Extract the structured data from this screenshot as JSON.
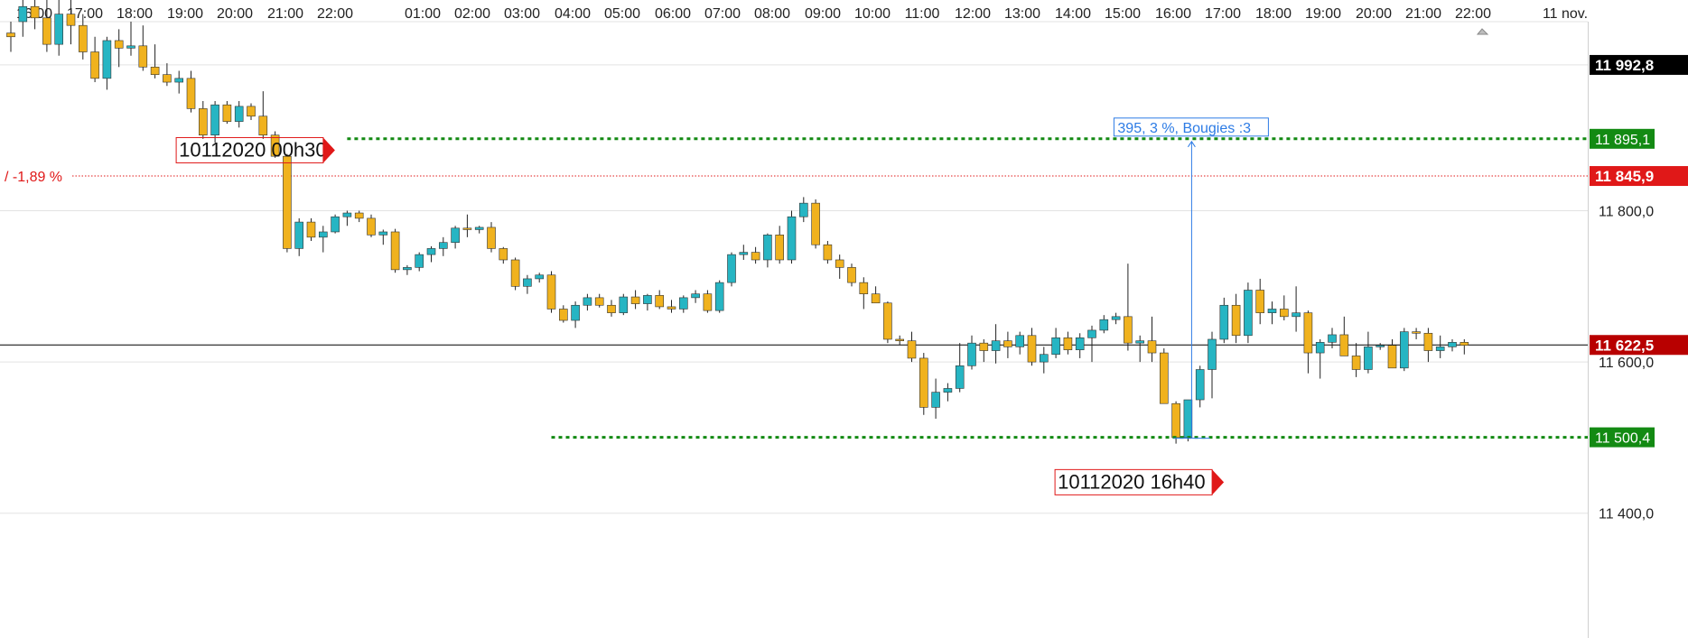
{
  "chart_data": {
    "type": "candlestick",
    "time_axis": {
      "labels": [
        "16:00",
        "17:00",
        "18:00",
        "19:00",
        "20:00",
        "21:00",
        "22:00",
        "01:00",
        "02:00",
        "03:00",
        "04:00",
        "05:00",
        "06:00",
        "07:00",
        "08:00",
        "09:00",
        "10:00",
        "11:00",
        "12:00",
        "13:00",
        "14:00",
        "15:00",
        "16:00",
        "17:00",
        "18:00",
        "19:00",
        "20:00",
        "21:00",
        "22:00",
        "11 nov."
      ]
    },
    "price_axis": {
      "ylim": [
        11235,
        12050
      ],
      "ticks": [
        "11 992,8",
        "11 800,0",
        "11 600,0",
        "11 400,0"
      ],
      "tick_values": [
        11992.8,
        11800.0,
        11600.0,
        11400.0
      ],
      "gridlines": [
        11992.8,
        11800.0,
        11600.0,
        11400.0
      ]
    },
    "price_badges": [
      {
        "label": "11 992,8",
        "value": 11992.8,
        "color": "#000000"
      },
      {
        "label": "11 895,1",
        "value": 11895.1,
        "color": "#138a13"
      },
      {
        "label": "11 845,9",
        "value": 11845.9,
        "color": "#e01818"
      },
      {
        "label": "11 622,5",
        "value": 11622.5,
        "color": "#b80000"
      },
      {
        "label": "11 500,4",
        "value": 11500.4,
        "color": "#138a13"
      }
    ],
    "reference_line": {
      "value": 11845.9,
      "label": "/ -1,89 %",
      "color": "#e01818"
    },
    "current_price_line": {
      "value": 11622.5,
      "color": "#000000"
    },
    "levels": [
      {
        "value": 11895.1,
        "color": "#138a13",
        "from_candle": 28
      },
      {
        "value": 11500.4,
        "color": "#138a13",
        "from_candle": 45
      }
    ],
    "markers": [
      {
        "text": "10112020 00h30",
        "candle": 23,
        "value": 11880
      },
      {
        "text": "10112020  16h40",
        "candle": 97,
        "value": 11441
      }
    ],
    "measure": {
      "label": "395, 3 %, Bougies :3",
      "candle": 98,
      "from": 11500.4,
      "to": 11895.1
    },
    "colors": {
      "up": "#26b5c3",
      "down": "#f0b21e",
      "wick": "#222222"
    },
    "candles": [
      [
        12035,
        12050,
        12010,
        12030
      ],
      [
        12050,
        12085,
        12030,
        12070
      ],
      [
        12070,
        12120,
        12040,
        12055
      ],
      [
        12055,
        12095,
        12010,
        12020
      ],
      [
        12020,
        12080,
        12005,
        12060
      ],
      [
        12060,
        12110,
        12020,
        12045
      ],
      [
        12045,
        12060,
        12000,
        12010
      ],
      [
        12010,
        12030,
        11970,
        11975
      ],
      [
        11975,
        12030,
        11960,
        12025
      ],
      [
        12025,
        12040,
        11990,
        12015
      ],
      [
        12015,
        12050,
        12005,
        12018
      ],
      [
        12018,
        12045,
        11985,
        11990
      ],
      [
        11990,
        12020,
        11975,
        11980
      ],
      [
        11980,
        11995,
        11965,
        11970
      ],
      [
        11970,
        11985,
        11955,
        11975
      ],
      [
        11975,
        11985,
        11930,
        11935
      ],
      [
        11935,
        11945,
        11895,
        11900
      ],
      [
        11900,
        11945,
        11890,
        11940
      ],
      [
        11940,
        11945,
        11915,
        11918
      ],
      [
        11918,
        11945,
        11910,
        11938
      ],
      [
        11938,
        11942,
        11920,
        11925
      ],
      [
        11925,
        11958,
        11895,
        11900
      ],
      [
        11900,
        11905,
        11870,
        11872
      ],
      [
        11872,
        11875,
        11745,
        11750
      ],
      [
        11750,
        11790,
        11740,
        11785
      ],
      [
        11785,
        11790,
        11760,
        11765
      ],
      [
        11765,
        11780,
        11745,
        11772
      ],
      [
        11772,
        11795,
        11770,
        11792
      ],
      [
        11792,
        11800,
        11780,
        11797
      ],
      [
        11797,
        11800,
        11785,
        11790
      ],
      [
        11790,
        11795,
        11765,
        11768
      ],
      [
        11768,
        11775,
        11755,
        11772
      ],
      [
        11772,
        11776,
        11718,
        11722
      ],
      [
        11722,
        11728,
        11715,
        11725
      ],
      [
        11725,
        11745,
        11720,
        11742
      ],
      [
        11742,
        11753,
        11732,
        11750
      ],
      [
        11750,
        11765,
        11740,
        11758
      ],
      [
        11758,
        11780,
        11750,
        11777
      ],
      [
        11777,
        11795,
        11765,
        11775
      ],
      [
        11775,
        11780,
        11770,
        11778
      ],
      [
        11778,
        11785,
        11745,
        11750
      ],
      [
        11750,
        11752,
        11730,
        11735
      ],
      [
        11735,
        11738,
        11695,
        11700
      ],
      [
        11700,
        11715,
        11690,
        11710
      ],
      [
        11710,
        11718,
        11705,
        11715
      ],
      [
        11715,
        11720,
        11665,
        11670
      ],
      [
        11670,
        11675,
        11652,
        11655
      ],
      [
        11655,
        11680,
        11645,
        11675
      ],
      [
        11675,
        11690,
        11668,
        11685
      ],
      [
        11685,
        11690,
        11672,
        11675
      ],
      [
        11675,
        11682,
        11660,
        11665
      ],
      [
        11665,
        11690,
        11662,
        11686
      ],
      [
        11686,
        11695,
        11670,
        11677
      ],
      [
        11677,
        11690,
        11668,
        11688
      ],
      [
        11688,
        11695,
        11670,
        11673
      ],
      [
        11673,
        11682,
        11665,
        11670
      ],
      [
        11670,
        11688,
        11665,
        11685
      ],
      [
        11685,
        11695,
        11678,
        11690
      ],
      [
        11690,
        11695,
        11665,
        11668
      ],
      [
        11668,
        11708,
        11665,
        11705
      ],
      [
        11705,
        11745,
        11700,
        11742
      ],
      [
        11742,
        11755,
        11735,
        11745
      ],
      [
        11745,
        11752,
        11730,
        11735
      ],
      [
        11735,
        11770,
        11725,
        11768
      ],
      [
        11768,
        11780,
        11730,
        11735
      ],
      [
        11735,
        11800,
        11730,
        11792
      ],
      [
        11792,
        11818,
        11785,
        11810
      ],
      [
        11810,
        11815,
        11750,
        11755
      ],
      [
        11755,
        11760,
        11730,
        11735
      ],
      [
        11735,
        11742,
        11710,
        11725
      ],
      [
        11725,
        11730,
        11700,
        11705
      ],
      [
        11705,
        11712,
        11670,
        11690
      ],
      [
        11690,
        11700,
        11680,
        11678
      ],
      [
        11678,
        11680,
        11625,
        11630
      ],
      [
        11630,
        11635,
        11622,
        11628
      ],
      [
        11628,
        11640,
        11600,
        11605
      ],
      [
        11605,
        11612,
        11530,
        11540
      ],
      [
        11540,
        11578,
        11525,
        11560
      ],
      [
        11560,
        11572,
        11548,
        11565
      ],
      [
        11565,
        11625,
        11560,
        11595
      ],
      [
        11595,
        11635,
        11590,
        11625
      ],
      [
        11625,
        11630,
        11600,
        11615
      ],
      [
        11615,
        11650,
        11598,
        11628
      ],
      [
        11628,
        11640,
        11605,
        11620
      ],
      [
        11620,
        11640,
        11610,
        11635
      ],
      [
        11635,
        11645,
        11595,
        11600
      ],
      [
        11600,
        11620,
        11585,
        11610
      ],
      [
        11610,
        11645,
        11605,
        11632
      ],
      [
        11632,
        11640,
        11610,
        11616
      ],
      [
        11616,
        11638,
        11605,
        11632
      ],
      [
        11632,
        11648,
        11600,
        11642
      ],
      [
        11642,
        11662,
        11638,
        11656
      ],
      [
        11656,
        11665,
        11650,
        11660
      ],
      [
        11660,
        11730,
        11615,
        11625
      ],
      [
        11625,
        11635,
        11600,
        11628
      ],
      [
        11628,
        11660,
        11600,
        11612
      ],
      [
        11612,
        11618,
        11545,
        11545
      ],
      [
        11545,
        11548,
        11492,
        11500
      ],
      [
        11500,
        11550,
        11495,
        11550
      ],
      [
        11550,
        11595,
        11540,
        11590
      ],
      [
        11590,
        11640,
        11552,
        11630
      ],
      [
        11630,
        11685,
        11625,
        11675
      ],
      [
        11675,
        11690,
        11625,
        11635
      ],
      [
        11635,
        11705,
        11625,
        11695
      ],
      [
        11695,
        11710,
        11650,
        11665
      ],
      [
        11665,
        11680,
        11650,
        11670
      ],
      [
        11670,
        11688,
        11655,
        11660
      ],
      [
        11660,
        11700,
        11640,
        11665
      ],
      [
        11665,
        11668,
        11585,
        11612
      ],
      [
        11612,
        11630,
        11578,
        11626
      ],
      [
        11626,
        11645,
        11618,
        11636
      ],
      [
        11636,
        11660,
        11608,
        11608
      ],
      [
        11608,
        11625,
        11580,
        11590
      ],
      [
        11590,
        11640,
        11585,
        11620
      ],
      [
        11620,
        11625,
        11616,
        11622
      ],
      [
        11622,
        11630,
        11592,
        11592
      ],
      [
        11592,
        11645,
        11588,
        11640
      ],
      [
        11640,
        11645,
        11630,
        11638
      ],
      [
        11638,
        11645,
        11600,
        11615
      ],
      [
        11615,
        11635,
        11605,
        11620
      ],
      [
        11620,
        11630,
        11614,
        11626
      ],
      [
        11626,
        11630,
        11610,
        11622
      ]
    ]
  }
}
